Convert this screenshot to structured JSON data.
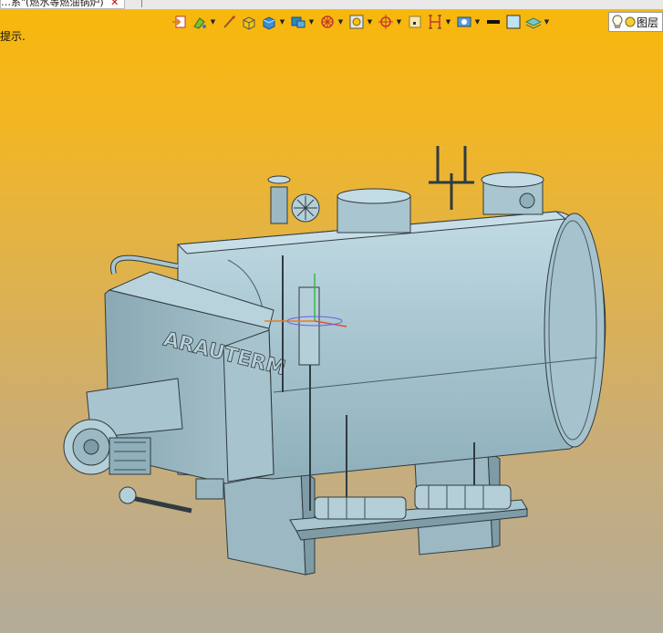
{
  "document_tab": {
    "title": "…系\"(燃水等燃油锅炉)",
    "close_glyph": "✕"
  },
  "hint_text": "提示.",
  "layers_label": "图层",
  "toolbar": {
    "icons": [
      "import-icon",
      "paint-icon",
      "brush-icon",
      "shading-icon",
      "shaded-box-icon",
      "view-cube-icon",
      "wheel-icon",
      "box-select-icon",
      "target-icon",
      "point-icon",
      "bracket-icon",
      "render-icon",
      "line-weight-icon",
      "color-swatch-icon",
      "layers-icon",
      "bulb-icon",
      "yellow-dot-icon"
    ]
  },
  "model": {
    "nameplate": "ARAUTERM"
  },
  "colors": {
    "accent_bg_top": "#f8b70a",
    "accent_bg_bottom": "#b3ac99",
    "metal": "#a9c5cf",
    "metal_dark": "#7f9ea9"
  }
}
